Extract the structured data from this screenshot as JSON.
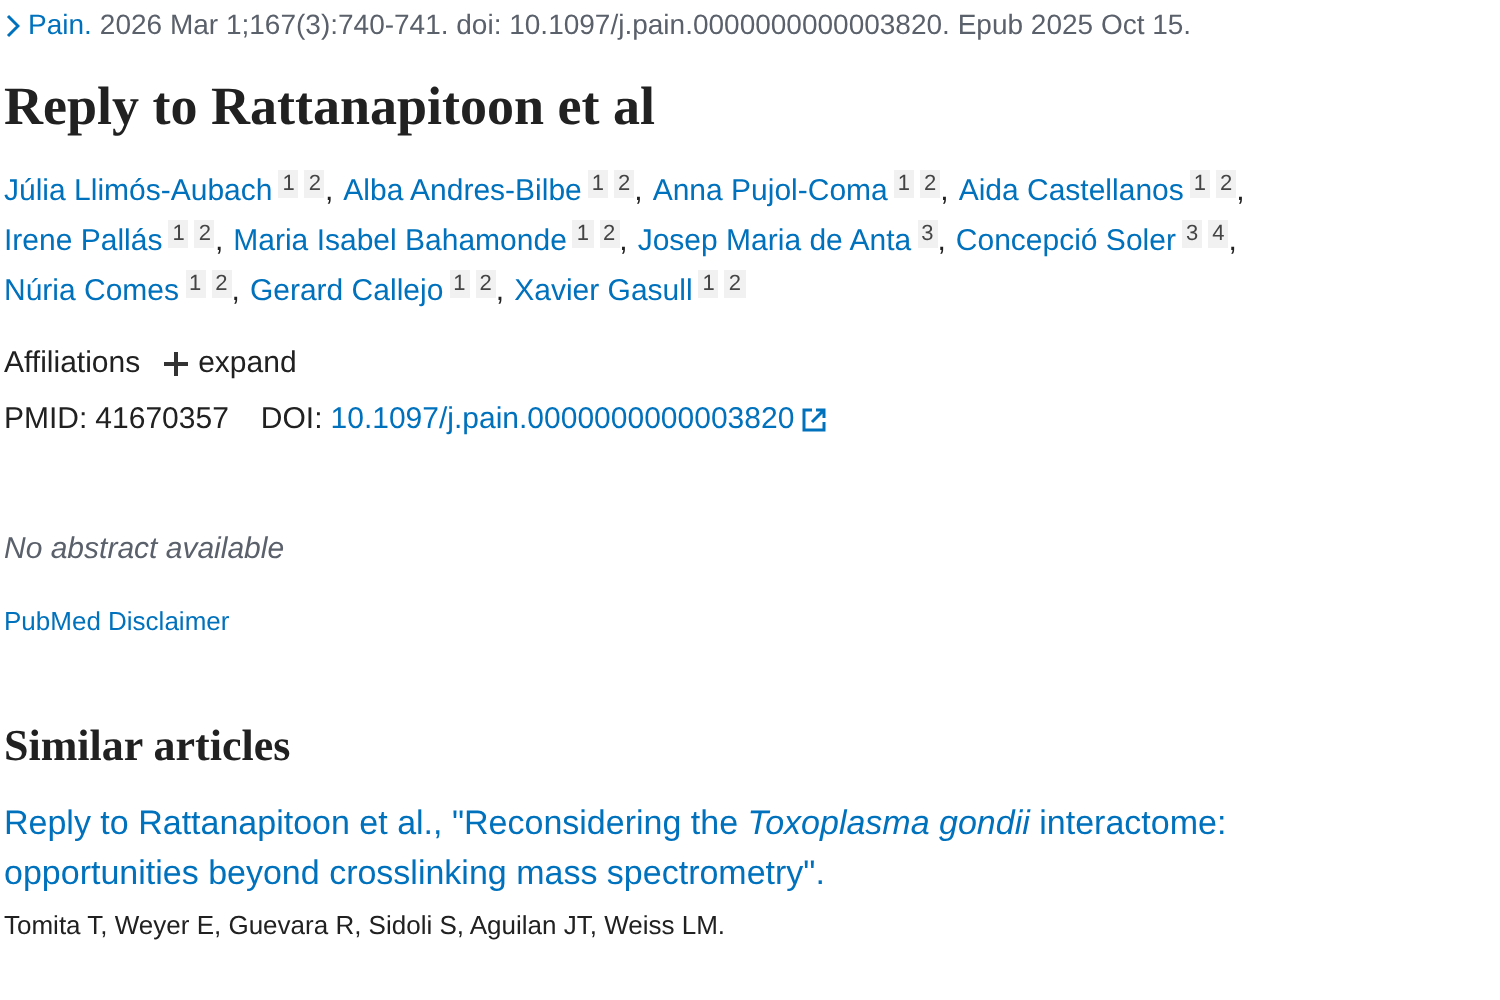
{
  "citation": {
    "journal": "Pain.",
    "details": "2026 Mar 1;167(3):740-741. doi: 10.1097/j.pain.0000000000003820. Epub 2025 Oct 15."
  },
  "title": "Reply to Rattanapitoon et al",
  "authors": [
    {
      "name": "Júlia Llimós-Aubach",
      "affiliations": [
        "1",
        "2"
      ],
      "separator": ","
    },
    {
      "name": "Alba Andres-Bilbe",
      "affiliations": [
        "1",
        "2"
      ],
      "separator": ","
    },
    {
      "name": "Anna Pujol-Coma",
      "affiliations": [
        "1",
        "2"
      ],
      "separator": ","
    },
    {
      "name": "Aida Castellanos",
      "affiliations": [
        "1",
        "2"
      ],
      "separator": ","
    },
    {
      "name": "Irene Pallás",
      "affiliations": [
        "1",
        "2"
      ],
      "separator": ","
    },
    {
      "name": "Maria Isabel Bahamonde",
      "affiliations": [
        "1",
        "2"
      ],
      "separator": ","
    },
    {
      "name": "Josep Maria de Anta",
      "affiliations": [
        "3"
      ],
      "separator": ","
    },
    {
      "name": "Concepció Soler",
      "affiliations": [
        "3",
        "4"
      ],
      "separator": ","
    },
    {
      "name": "Núria Comes",
      "affiliations": [
        "1",
        "2"
      ],
      "separator": ","
    },
    {
      "name": "Gerard Callejo",
      "affiliations": [
        "1",
        "2"
      ],
      "separator": ","
    },
    {
      "name": "Xavier Gasull",
      "affiliations": [
        "1",
        "2"
      ]
    }
  ],
  "affiliations": {
    "label": "Affiliations",
    "toggle": "expand",
    "expanded": false
  },
  "ids": {
    "pmid_label": "PMID:",
    "pmid": "41670357",
    "doi_label": "DOI:",
    "doi": "10.1097/j.pain.0000000000003820"
  },
  "abstract": "No abstract available",
  "disclaimer": "PubMed Disclaimer",
  "similar": {
    "heading": "Similar articles",
    "articles": [
      {
        "title": "Reply to Rattanapitoon et al., \"Reconsidering the *Toxoplasma gondii* interactome: opportunities beyond crosslinking mass spectrometry\".",
        "authors": "Tomita T, Weyer E, Guevara R, Sidoli S, Aguilan JT, Weiss LM."
      }
    ]
  }
}
